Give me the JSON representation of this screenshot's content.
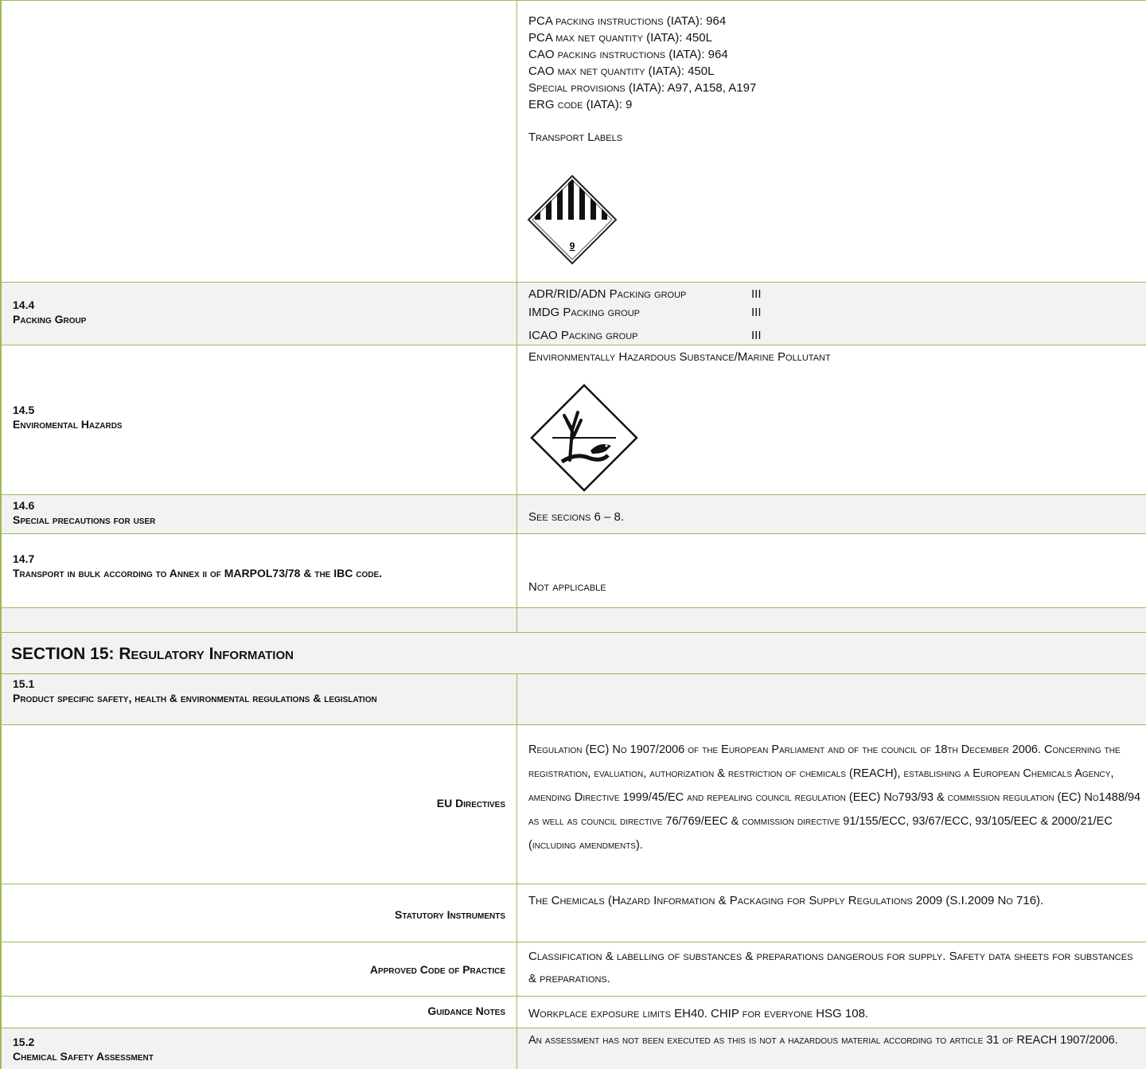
{
  "iata": {
    "lines": [
      "PCA packing instructions (IATA):  964",
      "PCA max net quantity (IATA):  450L",
      "CAO packing instructions (IATA):  964",
      "CAO max net quantity (IATA):  450L",
      "Special provisions (IATA):  A97, A158, A197",
      "ERG code (IATA):  9"
    ],
    "labels_title": "Transport Labels",
    "label_icon": "class-9-miscellaneous-hazard-icon",
    "label_number": "9"
  },
  "s14_4": {
    "num": "14.4",
    "title": "Packing Group",
    "items": [
      {
        "key": "ADR/RID/ADN Packing group",
        "value": "III"
      },
      {
        "key": "IMDG Packing group",
        "value": "III"
      },
      {
        "key": "ICAO Packing group",
        "value": "III"
      }
    ]
  },
  "s14_5": {
    "num": "14.5",
    "title": "Enviromental Hazards",
    "text": "Environmentally Hazardous Substance/Marine Pollutant",
    "icon": "environmental-hazard-icon"
  },
  "s14_6": {
    "num": "14.6",
    "title": "Special precautions for user",
    "text": "See secions 6 – 8."
  },
  "s14_7": {
    "num": "14.7",
    "title": "Transport in bulk according to Annex ii of MARPOL73/78 & the IBC code.",
    "text": "Not applicable"
  },
  "section15": {
    "title": "SECTION 15: Regulatory Information"
  },
  "s15_1": {
    "num": "15.1",
    "title": "Product specific safety, health & environmental regulations & legislation"
  },
  "eu_directives": {
    "label": "EU Directives",
    "text": "Regulation (EC) No 1907/2006 of the European Parliament and of the council of 18th December 2006. Concerning the registration, evaluation, authorization & restriction of chemicals (REACH), establishing a European Chemicals Agency, amending Directive 1999/45/EC and repealing council regulation (EEC) No793/93 & commission regulation (EC) No1488/94 as well as council directive 76/769/EEC & commission directive 91/155/ECC, 93/67/ECC, 93/105/EEC & 2000/21/EC (including amendments)."
  },
  "statutory": {
    "label": "Statutory Instruments",
    "text": "The Chemicals (Hazard Information & Packaging for Supply Regulations 2009 (S.I.2009 No 716)."
  },
  "acop": {
    "label": "Approved Code of Practice",
    "text": "Classification & labelling of substances & preparations dangerous for supply. Safety data sheets for substances & preparations."
  },
  "guidance": {
    "label": "Guidance Notes",
    "text": "Workplace exposure limits EH40. CHIP for everyone HSG 108."
  },
  "s15_2": {
    "num": "15.2",
    "title": "Chemical Safety Assessment",
    "text": "An assessment has not been executed as this is not a hazardous material according to article 31 of REACH 1907/2006."
  }
}
